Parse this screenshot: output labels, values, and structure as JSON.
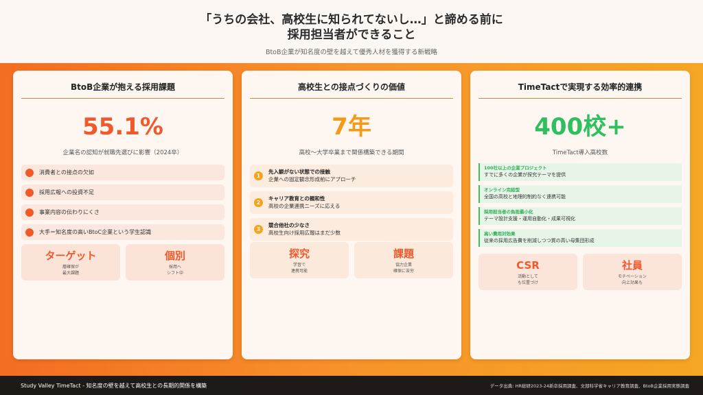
{
  "header": {
    "title_line1": "「うちの会社、高校生に知られてないし…」と諦める前に",
    "title_line2": "採用担当者ができること",
    "subtitle": "BtoB企業が知名度の壁を越えて優秀人材を獲得する新戦略"
  },
  "cards": [
    {
      "title": "BtoB企業が抱える採用課題",
      "stat": "55.1%",
      "caption": "企業名の認知が就職先選びに影響（2024卒）",
      "items": [
        "消費者との接点の欠如",
        "採用広報への投資不足",
        "事業内容の伝わりにくさ",
        "大手＝知名度の高いBtoC企業という学生認識"
      ],
      "boxes": [
        {
          "head": "ターゲット",
          "sub": "層確保が\n最大課題"
        },
        {
          "head": "個別",
          "sub": "採用へ\nシフト中"
        }
      ]
    },
    {
      "title": "高校生との接点づくりの価値",
      "stat": "7年",
      "caption": "高校〜大学卒業まで関係構築できる期間",
      "items": [
        {
          "num": "1",
          "title": "先入観がない状態での接触",
          "desc": "企業への固定観念形成前にアプローチ"
        },
        {
          "num": "2",
          "title": "キャリア教育との親和性",
          "desc": "高校の企業連携ニーズに応える"
        },
        {
          "num": "3",
          "title": "競合他社の少なさ",
          "desc": "高校生向け採用広報はまだ少数"
        }
      ],
      "boxes": [
        {
          "head": "探究",
          "sub": "学習で\n連携可能"
        },
        {
          "head": "課題",
          "sub": "協力企業\n確保に苦労"
        }
      ]
    },
    {
      "title": "TimeTactで実現する効率的連携",
      "stat": "400校+",
      "caption": "TimeTact導入高校数",
      "items": [
        {
          "title": "100社以上の企業プロジェクト",
          "desc": "すでに多くの企業が探究テーマを提供"
        },
        {
          "title": "オンライン完結型",
          "desc": "全国の高校と地理的制約なく連携可能"
        },
        {
          "title": "採用担当者の負担最小化",
          "desc": "テーマ設計支援・運用自動化・成果可視化"
        },
        {
          "title": "高い費用対効果",
          "desc": "従来の採用広告費を削減しつつ質の高い母集団形成"
        }
      ],
      "boxes": [
        {
          "head": "CSR",
          "sub": "活動として\nも位置づけ"
        },
        {
          "head": "社員",
          "sub": "モチベーション\n向上効果も"
        }
      ]
    }
  ],
  "footer": {
    "left": "Study Valley TimeTact - 知名度の壁を越えて高校生との長期的関係を構築",
    "right": "データ出典: HR総研2023-24新卒採用調査、文部科学省キャリア教育調査、BtoB企業採用実態調査"
  },
  "colors": {
    "accent_orange": "#f0592b",
    "accent_amber": "#f59a16",
    "accent_green": "#2fbf5f",
    "footer_bg": "#1e1a18"
  }
}
